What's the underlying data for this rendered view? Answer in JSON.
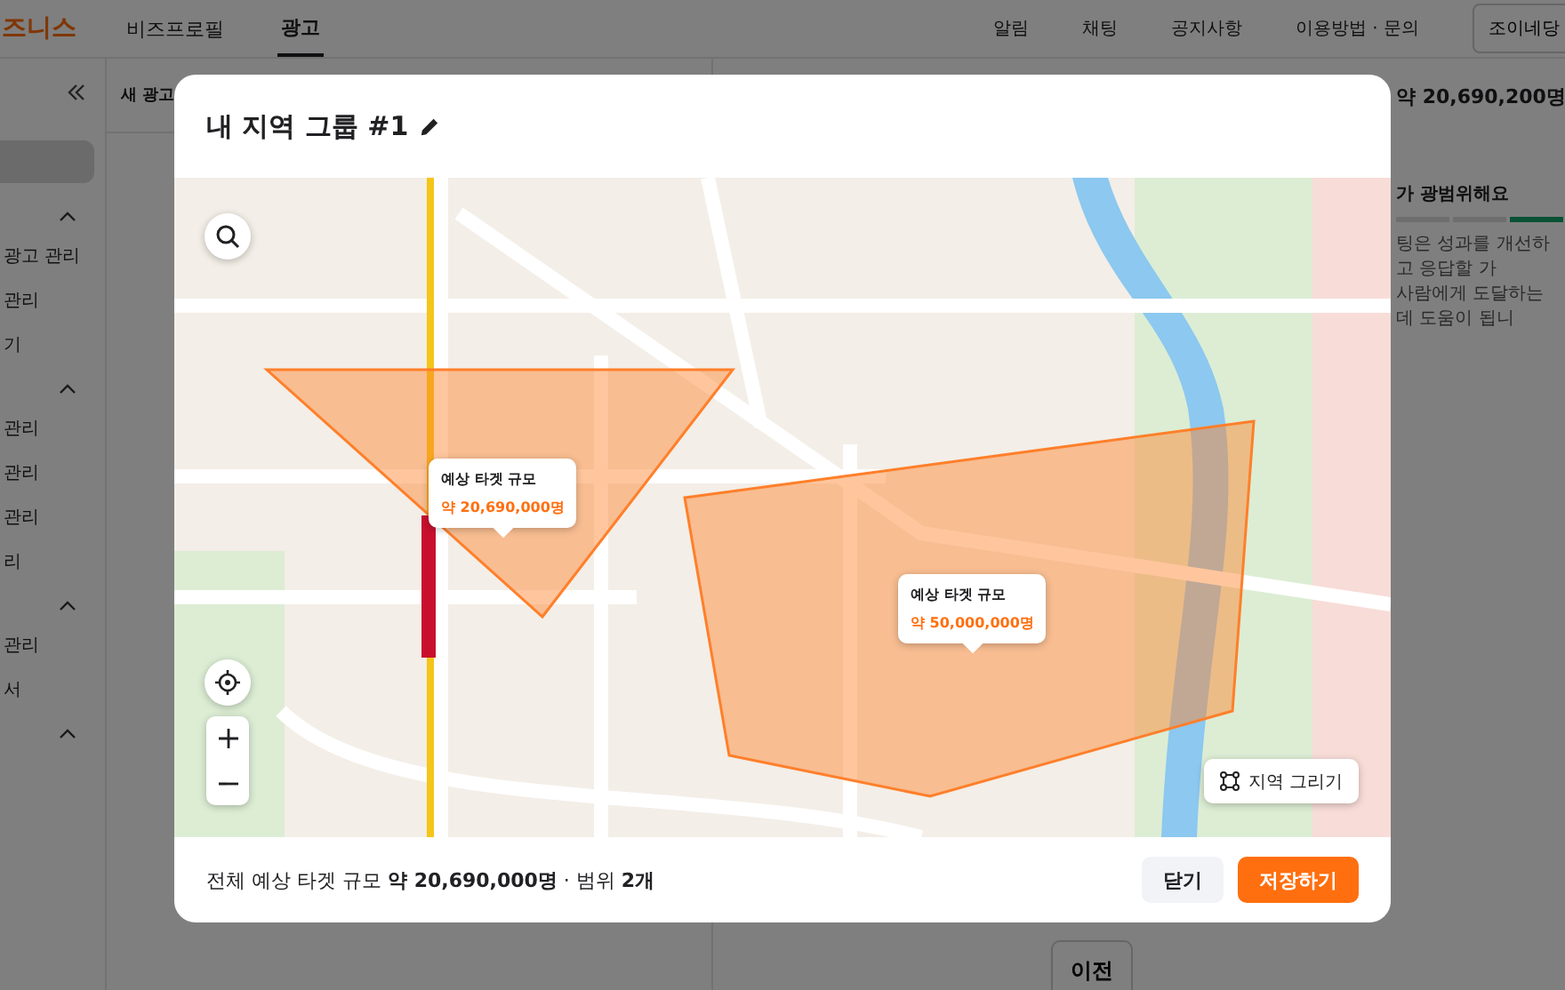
{
  "app_header": {
    "logo": "즈니스",
    "tabs": [
      {
        "label": "비즈프로필",
        "selected": false
      },
      {
        "label": "광고",
        "selected": true
      }
    ],
    "nav": [
      "알림",
      "채팅",
      "공지사항",
      "이용방법 · 문의"
    ],
    "account_button": "조이네당"
  },
  "sidebar": {
    "groups": [
      {
        "expanded": true,
        "items": [
          "광고 관리",
          "관리",
          "기"
        ]
      },
      {
        "expanded": true,
        "items": [
          "관리",
          "관리",
          "관리",
          "리"
        ]
      },
      {
        "expanded": true,
        "items": [
          "관리",
          "서"
        ]
      },
      {
        "expanded": true
      }
    ]
  },
  "panel": {
    "title": "새 광고"
  },
  "summary": {
    "reach": "약 20,690,200명",
    "notice": "가 광범위해요",
    "description": [
      "팅은 성과를 개선하고 응답할 가",
      "사람에게 도달하는 데 도움이 됩니"
    ]
  },
  "prev_button": "이전",
  "dialog": {
    "title": "내 지역 그룹 #1",
    "areas": [
      {
        "label": "예상 타겟 규모",
        "value": "약 20,690,000명"
      },
      {
        "label": "예상 타겟 규모",
        "value": "약 50,000,000명"
      }
    ],
    "draw_button": "지역 그리기",
    "footer": {
      "summary": "전체 예상 타겟 규모 **약 20,690,000명** · 범위 **2개**",
      "buttons": [
        {
          "label": "닫기",
          "kind": "secondary"
        },
        {
          "label": "저장하기",
          "kind": "primary"
        }
      ]
    }
  }
}
